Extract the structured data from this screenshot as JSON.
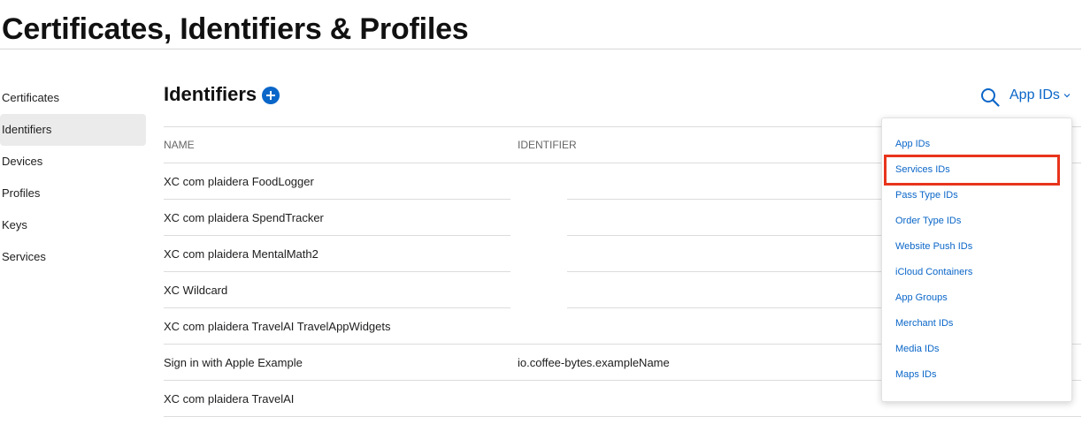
{
  "page": {
    "title": "Certificates, Identifiers & Profiles"
  },
  "sidebar": {
    "items": [
      {
        "label": "Certificates"
      },
      {
        "label": "Identifiers"
      },
      {
        "label": "Devices"
      },
      {
        "label": "Profiles"
      },
      {
        "label": "Keys"
      },
      {
        "label": "Services"
      }
    ],
    "active": "Identifiers"
  },
  "section": {
    "title": "Identifiers",
    "add_icon": "plus-circle-icon"
  },
  "toolbar": {
    "search_icon": "search-icon",
    "filter_label": "App IDs"
  },
  "table": {
    "headers": {
      "name": "NAME",
      "identifier": "IDENTIFIER"
    },
    "rows": [
      {
        "name": "XC com plaidera FoodLogger",
        "identifier": ""
      },
      {
        "name": "XC com plaidera SpendTracker",
        "identifier": ""
      },
      {
        "name": "XC com plaidera MentalMath2",
        "identifier": ""
      },
      {
        "name": "XC Wildcard",
        "identifier": ""
      },
      {
        "name": "XC com plaidera TravelAI TravelAppWidgets",
        "identifier": ""
      },
      {
        "name": "Sign in with Apple Example",
        "identifier": "io.coffee-bytes.exampleName"
      },
      {
        "name": "XC com plaidera TravelAI",
        "identifier": ""
      }
    ]
  },
  "dropdown": {
    "items": [
      {
        "label": "App IDs"
      },
      {
        "label": "Services IDs"
      },
      {
        "label": "Pass Type IDs"
      },
      {
        "label": "Order Type IDs"
      },
      {
        "label": "Website Push IDs"
      },
      {
        "label": "iCloud Containers"
      },
      {
        "label": "App Groups"
      },
      {
        "label": "Merchant IDs"
      },
      {
        "label": "Media IDs"
      },
      {
        "label": "Maps IDs"
      }
    ],
    "highlighted": "Services IDs"
  },
  "colors": {
    "accent": "#0a66c8",
    "highlight": "#e8341c",
    "active_bg": "#ebebeb"
  }
}
